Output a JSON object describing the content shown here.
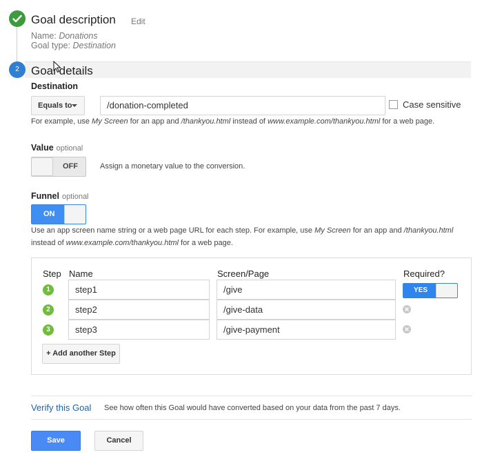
{
  "goal_description": {
    "step_icon": "check-icon",
    "title": "Goal description",
    "edit_label": "Edit",
    "name_label": "Name:",
    "name_value": "Donations",
    "type_label": "Goal type:",
    "type_value": "Destination"
  },
  "goal_details": {
    "step_number": "2",
    "title": "Goal details"
  },
  "destination": {
    "label": "Destination",
    "match_type": "Equals to",
    "value": "/donation-completed",
    "case_sensitive_label": "Case sensitive",
    "case_sensitive_checked": false,
    "hint_parts": [
      "For example, use ",
      "My Screen",
      " for an app and ",
      "/thankyou.html",
      " instead of ",
      "www.example.com/thankyou.html",
      " for a web page."
    ]
  },
  "value": {
    "label": "Value",
    "optional": "optional",
    "toggle_state": "OFF",
    "hint": "Assign a monetary value to the conversion."
  },
  "funnel": {
    "label": "Funnel",
    "optional": "optional",
    "toggle_state": "ON",
    "hint_line1_parts": [
      "Use an app screen name string or a web page URL for each step. For example, use ",
      "My Screen",
      " for an app and ",
      "/thankyou.html"
    ],
    "hint_line2_parts": [
      "instead of ",
      "www.example.com/thankyou.html",
      " for a web page."
    ],
    "columns": {
      "step": "Step",
      "name": "Name",
      "page": "Screen/Page",
      "required": "Required?"
    },
    "steps": [
      {
        "number": "1",
        "name": "step1",
        "page": "/give"
      },
      {
        "number": "2",
        "name": "step2",
        "page": "/give-data"
      },
      {
        "number": "3",
        "name": "step3",
        "page": "/give-payment"
      }
    ],
    "required_state": "YES",
    "add_step_label": "+ Add another Step"
  },
  "verify": {
    "link": "Verify this Goal",
    "hint": "See how often this Goal would have converted based on your data from the past 7 days."
  },
  "actions": {
    "save": "Save",
    "cancel": "Cancel"
  },
  "colors": {
    "complete_green": "#3d9a3e",
    "step_blue": "#2f7fd3",
    "toggle_blue": "#3f8ef2",
    "funnel_green": "#6fbd3a",
    "link_blue": "#2262a8"
  }
}
